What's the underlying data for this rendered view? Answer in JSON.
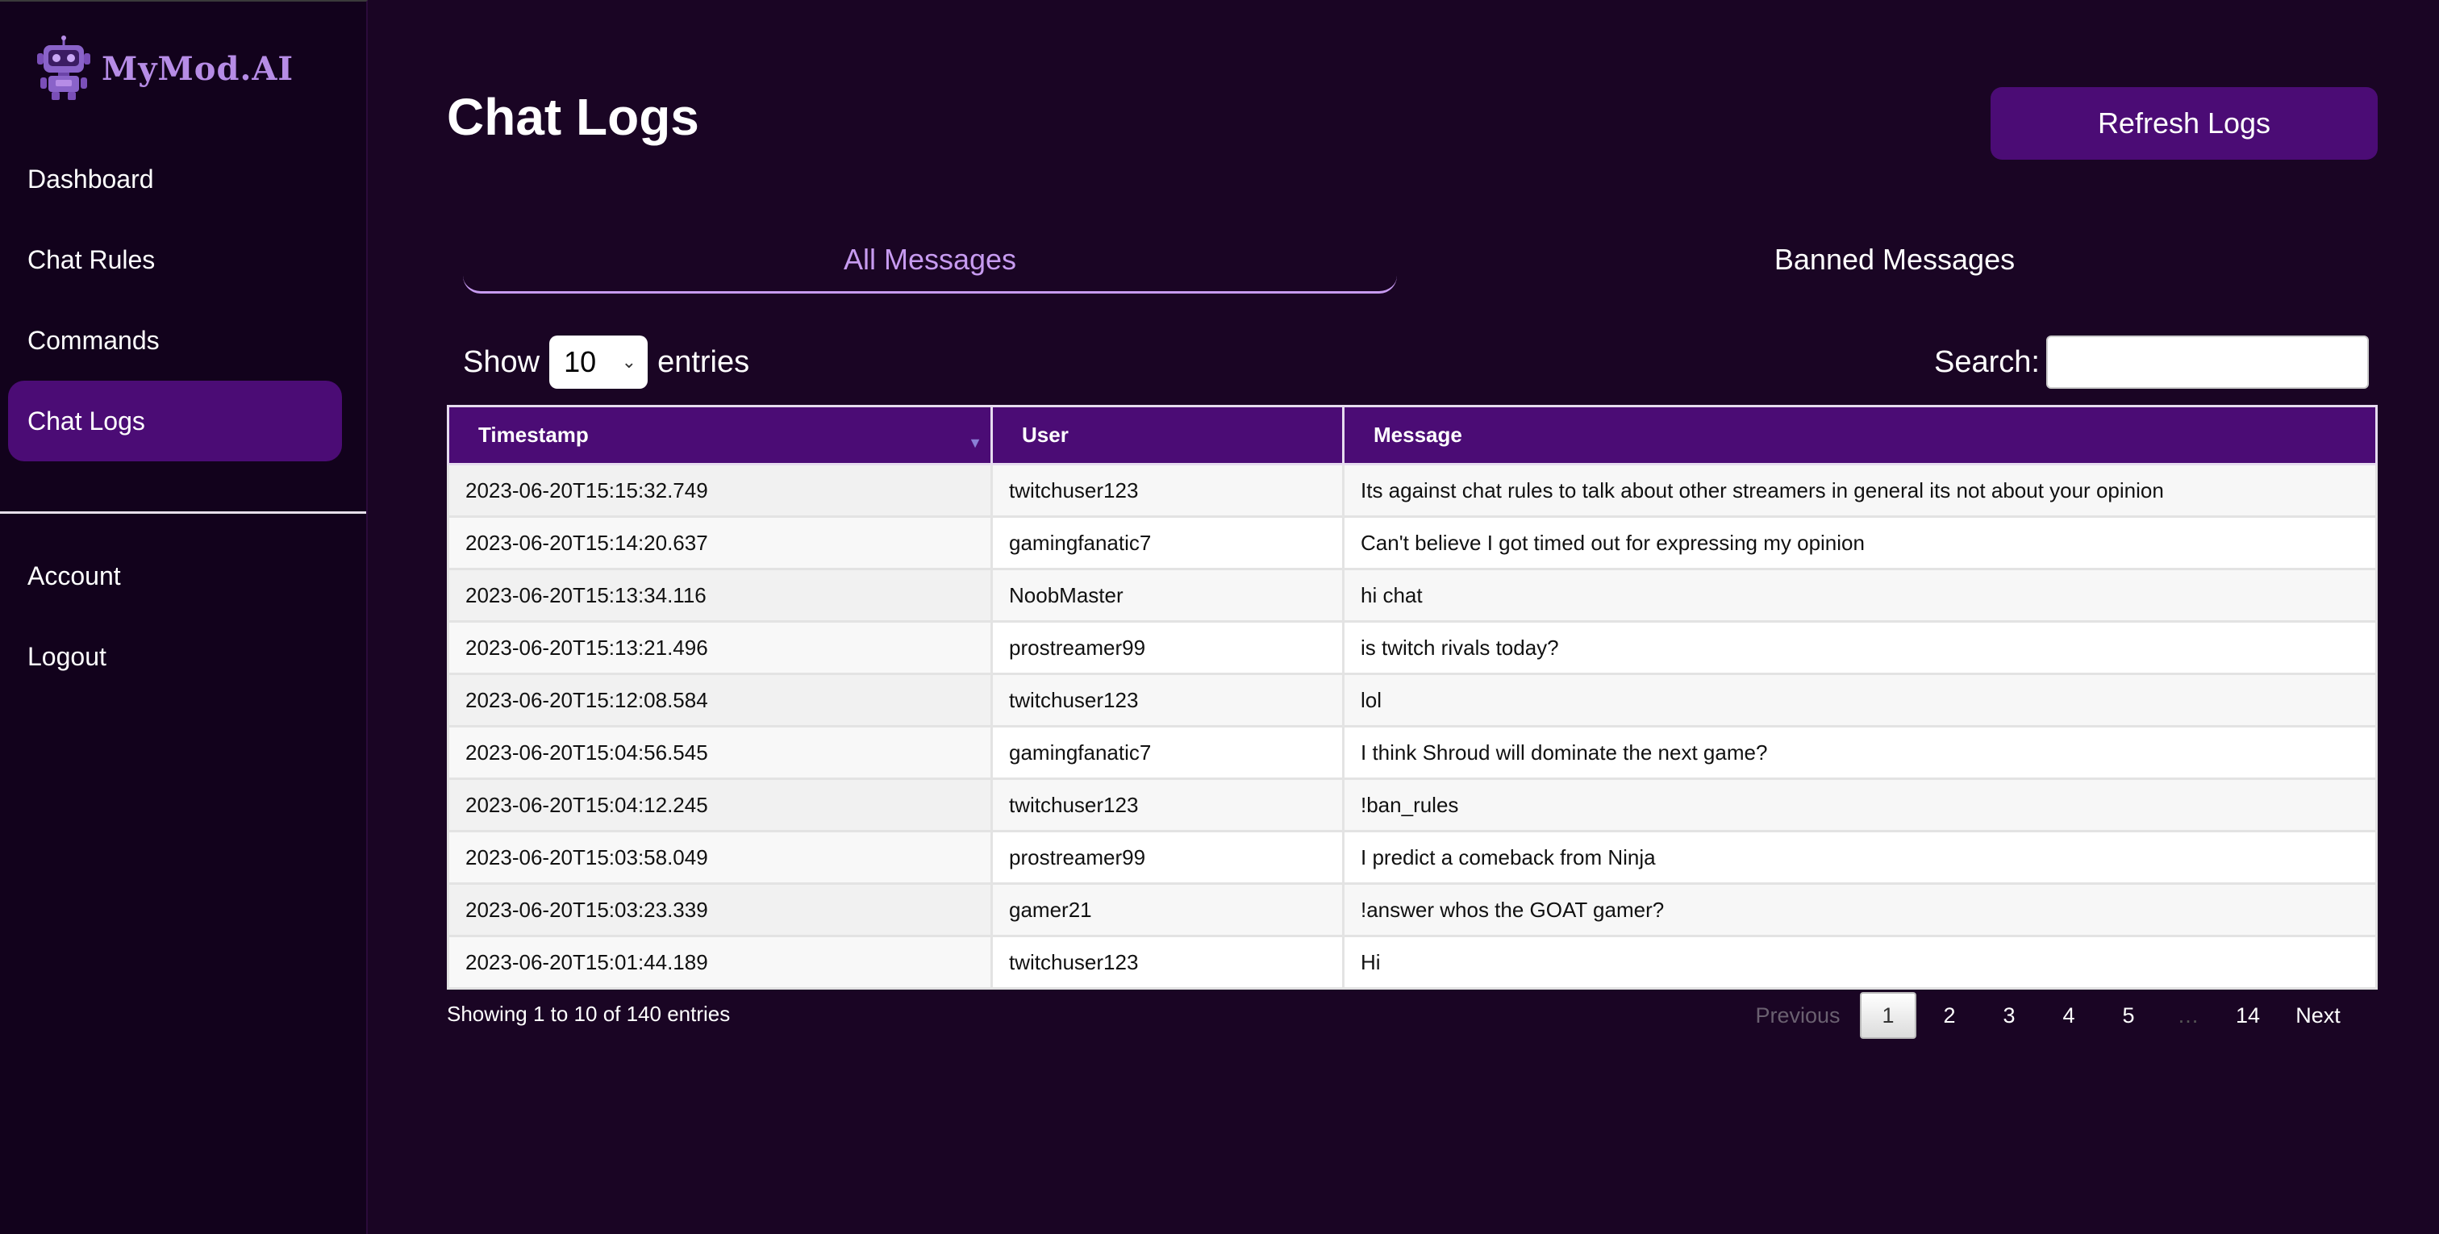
{
  "app": {
    "logo_text": "MyMod.AI",
    "colors": {
      "accent": "#4b0c75",
      "background": "#1a0524",
      "sidebar": "#12021c",
      "tab_active": "#c79bf0"
    }
  },
  "sidebar": {
    "items": [
      {
        "label": "Dashboard",
        "active": false
      },
      {
        "label": "Chat Rules",
        "active": false
      },
      {
        "label": "Commands",
        "active": false
      },
      {
        "label": "Chat Logs",
        "active": true
      }
    ],
    "secondary_items": [
      {
        "label": "Account"
      },
      {
        "label": "Logout"
      }
    ]
  },
  "header": {
    "title": "Chat Logs",
    "refresh_label": "Refresh Logs"
  },
  "tabs": [
    {
      "label": "All Messages",
      "active": true
    },
    {
      "label": "Banned Messages",
      "active": false
    }
  ],
  "controls": {
    "show_label": "Show",
    "page_length": "10",
    "entries_label": "entries",
    "search_label": "Search:",
    "search_value": ""
  },
  "table": {
    "columns": [
      "Timestamp",
      "User",
      "Message"
    ],
    "sort_indicator": "▼",
    "rows": [
      [
        "2023-06-20T15:15:32.749",
        "twitchuser123",
        "Its against chat rules to talk about other streamers in general its not about your opinion"
      ],
      [
        "2023-06-20T15:14:20.637",
        "gamingfanatic7",
        "Can't believe I got timed out for expressing my opinion"
      ],
      [
        "2023-06-20T15:13:34.116",
        "NoobMaster",
        "hi chat"
      ],
      [
        "2023-06-20T15:13:21.496",
        "prostreamer99",
        "is twitch rivals today?"
      ],
      [
        "2023-06-20T15:12:08.584",
        "twitchuser123",
        "lol"
      ],
      [
        "2023-06-20T15:04:56.545",
        "gamingfanatic7",
        "I think Shroud will dominate the next game?"
      ],
      [
        "2023-06-20T15:04:12.245",
        "twitchuser123",
        "!ban_rules"
      ],
      [
        "2023-06-20T15:03:58.049",
        "prostreamer99",
        "I predict a comeback from Ninja"
      ],
      [
        "2023-06-20T15:03:23.339",
        "gamer21",
        "!answer whos the GOAT gamer?"
      ],
      [
        "2023-06-20T15:01:44.189",
        "twitchuser123",
        "Hi"
      ]
    ]
  },
  "pagination": {
    "info": "Showing 1 to 10 of 140 entries",
    "previous": "Previous",
    "pages": [
      "1",
      "2",
      "3",
      "4",
      "5"
    ],
    "ellipsis": "…",
    "last": "14",
    "next": "Next",
    "current": "1"
  }
}
